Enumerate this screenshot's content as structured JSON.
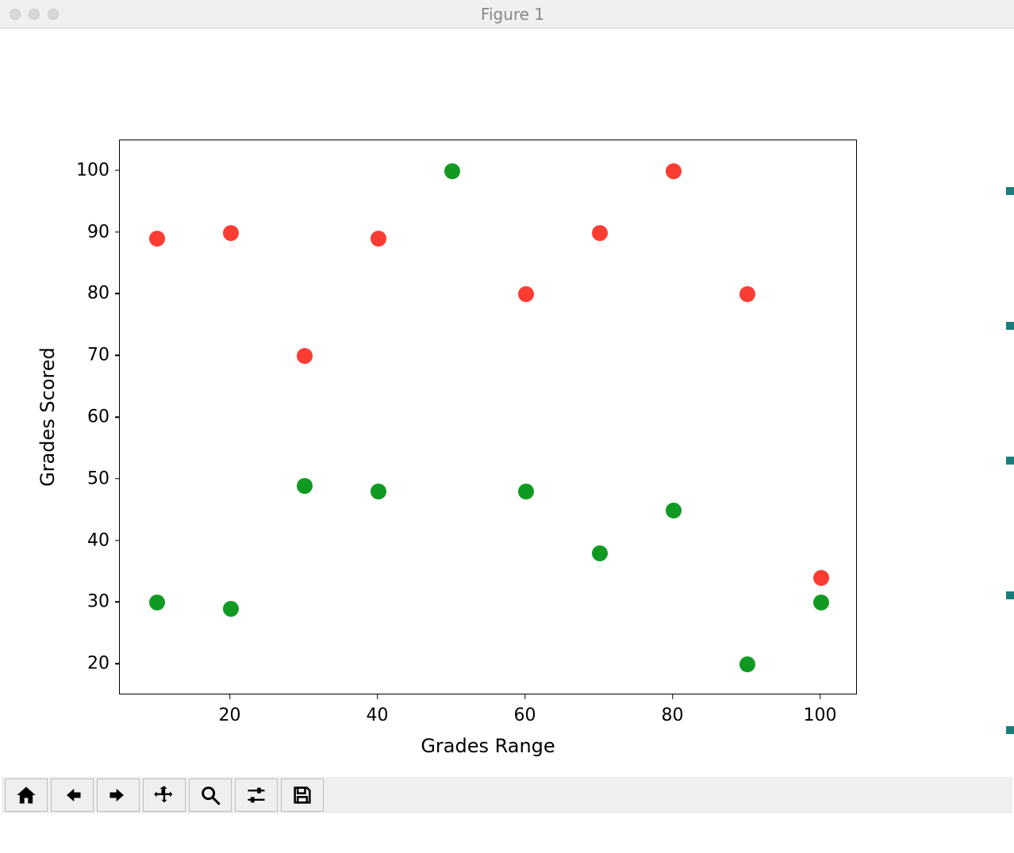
{
  "window": {
    "title": "Figure 1"
  },
  "chart_data": {
    "type": "scatter",
    "xlabel": "Grades Range",
    "ylabel": "Grades Scored",
    "xlim": [
      5,
      105
    ],
    "ylim": [
      15,
      105
    ],
    "xticks": [
      20,
      40,
      60,
      80,
      100
    ],
    "yticks": [
      20,
      30,
      40,
      50,
      60,
      70,
      80,
      90,
      100
    ],
    "series": [
      {
        "name": "red",
        "color": "#fa3c32",
        "points": [
          {
            "x": 10,
            "y": 89
          },
          {
            "x": 20,
            "y": 90
          },
          {
            "x": 30,
            "y": 70
          },
          {
            "x": 40,
            "y": 89
          },
          {
            "x": 60,
            "y": 80
          },
          {
            "x": 70,
            "y": 90
          },
          {
            "x": 80,
            "y": 100
          },
          {
            "x": 90,
            "y": 80
          },
          {
            "x": 100,
            "y": 34
          }
        ]
      },
      {
        "name": "green",
        "color": "#119a22",
        "points": [
          {
            "x": 10,
            "y": 30
          },
          {
            "x": 20,
            "y": 29
          },
          {
            "x": 30,
            "y": 49
          },
          {
            "x": 40,
            "y": 48
          },
          {
            "x": 50,
            "y": 100
          },
          {
            "x": 60,
            "y": 48
          },
          {
            "x": 70,
            "y": 38
          },
          {
            "x": 80,
            "y": 45
          },
          {
            "x": 90,
            "y": 20
          },
          {
            "x": 100,
            "y": 30
          }
        ]
      }
    ]
  },
  "toolbar": {
    "items": [
      "home",
      "back",
      "forward",
      "pan",
      "zoom",
      "configure",
      "save"
    ]
  }
}
